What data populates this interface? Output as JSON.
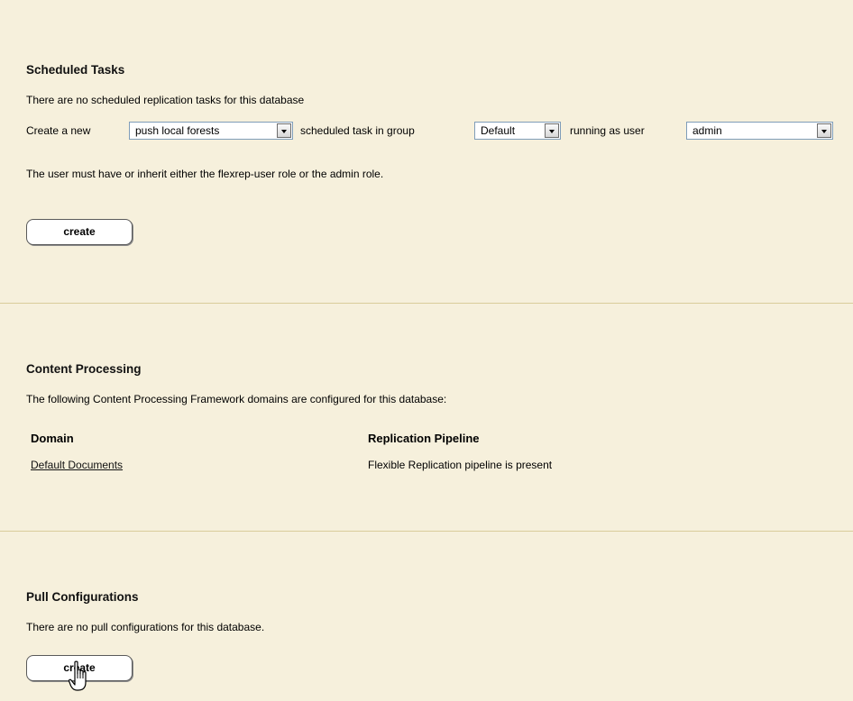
{
  "scheduled_tasks": {
    "title": "Scheduled Tasks",
    "no_tasks_text": "There are no scheduled replication tasks for this database",
    "create_prefix": "Create a new",
    "task_type_value": "push local forests",
    "task_group_label": "scheduled task in group",
    "group_value": "Default",
    "running_as_label": "running as user",
    "user_value": "admin",
    "role_note": "The user must have or inherit either the flexrep-user role or the admin role.",
    "create_button": "create"
  },
  "content_processing": {
    "title": "Content Processing",
    "description": "The following Content Processing Framework domains are configured for this database:",
    "columns": [
      "Domain",
      "Replication Pipeline"
    ],
    "rows": [
      {
        "domain": "Default Documents",
        "pipeline": "Flexible Replication pipeline is present"
      }
    ]
  },
  "pull_configurations": {
    "title": "Pull Configurations",
    "no_configs_text": "There are no pull configurations for this database.",
    "create_button": "create"
  },
  "icons": {
    "dropdown_arrow": "chevron-down-icon",
    "cursor": "hand-pointer-icon"
  },
  "colors": {
    "background": "#f6f0dc",
    "divider": "#d9cc9a"
  }
}
